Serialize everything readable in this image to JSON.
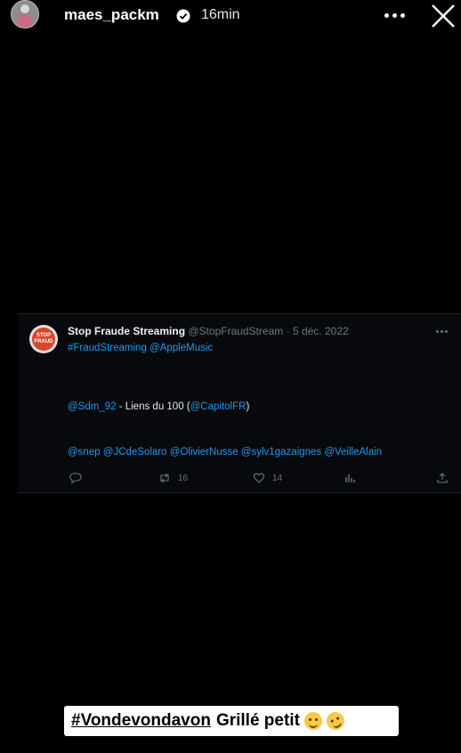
{
  "story": {
    "username": "maes_packm",
    "time": "16min"
  },
  "tweet": {
    "author_name": "Stop Fraude Streaming",
    "author_handle": "@StopFraudStream",
    "date": "· 5 déc. 2022",
    "avatar_text": [
      "STOP",
      "FRAUD"
    ],
    "line1": "#FraudStreaming @AppleMusic",
    "line2_mention": "@Sdm_92",
    "line2_text": " - Liens du 100 (",
    "line2_mention2": "@CapitolFR",
    "line2_end": ")",
    "line3": "@snep @JCdeSolaro @OlivierNusse @sylv1gazaignes @VeilleAlain",
    "retweets": "16",
    "likes": "14",
    "link_color": "#1d9bf0"
  },
  "caption": {
    "hashtag": "#Vondevondavon",
    "text": "Grillé petit"
  }
}
